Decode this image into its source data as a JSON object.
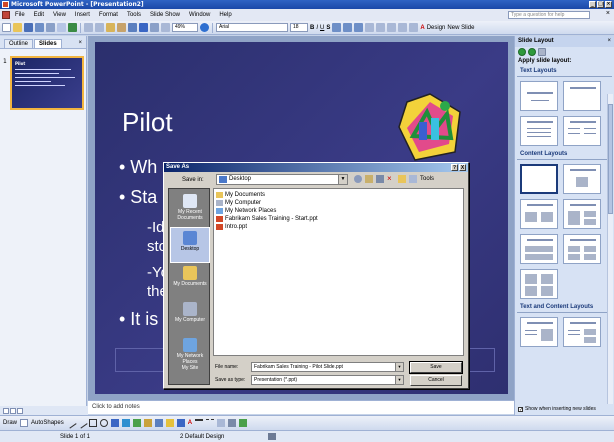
{
  "window": {
    "title": "Microsoft PowerPoint - [Presentation2]",
    "question_box": "Type a question for help"
  },
  "menu": [
    "File",
    "Edit",
    "View",
    "Insert",
    "Format",
    "Tools",
    "Slide Show",
    "Window",
    "Help"
  ],
  "toolbar": {
    "zoom": "49%",
    "font": "Arial",
    "font_size": "18",
    "bold": "B",
    "italic": "I",
    "underline": "U",
    "shadow": "S",
    "font_color": "A",
    "design": "Design",
    "new_slide": "New Slide"
  },
  "left_pane": {
    "tabs": [
      "Outline",
      "Slides"
    ],
    "close": "×",
    "slide_number": "1",
    "thumb_title": "Pilot"
  },
  "slide": {
    "title": "Pilot",
    "bullets": [
      "• Wh",
      "• Sta",
      "• It is"
    ],
    "subs": [
      "-Ide",
      "sto",
      "-Yo",
      "the"
    ]
  },
  "notes": "Click to add notes",
  "draw_toolbar": {
    "draw": "Draw",
    "autoshapes": "AutoShapes"
  },
  "status": {
    "slide": "Slide 1 of 1",
    "design": "2 Default Design"
  },
  "task_pane": {
    "title": "Slide Layout",
    "close": "×",
    "apply_label": "Apply slide layout:",
    "sections": [
      "Text Layouts",
      "Content Layouts",
      "Text and Content Layouts"
    ],
    "footer": "Show when inserting new slides"
  },
  "dialog": {
    "title": "Save As",
    "help": "?",
    "close": "X",
    "save_in_label": "Save in:",
    "save_in_value": "Desktop",
    "tools": "Tools",
    "places": [
      "My Recent Documents",
      "Desktop",
      "My Documents",
      "My Computer",
      "My Network Places",
      "My Site"
    ],
    "files": [
      "My Documents",
      "My Computer",
      "My Network Places",
      "Fabrikam Sales Training - Start.ppt",
      "Intro.ppt"
    ],
    "file_name_label": "File name:",
    "file_name_value": "Fabrikam Sales Training - Pilot Slide.ppt",
    "save_type_label": "Save as type:",
    "save_type_value": "Presentation (*.ppt)",
    "save_button": "Save",
    "cancel_button": "Cancel"
  },
  "colors": {
    "slide_bg": "#2b2f6d",
    "title_bar": "#1b48a8",
    "dialog_title": "#0a246a",
    "thumb_border": "#f2b540"
  }
}
